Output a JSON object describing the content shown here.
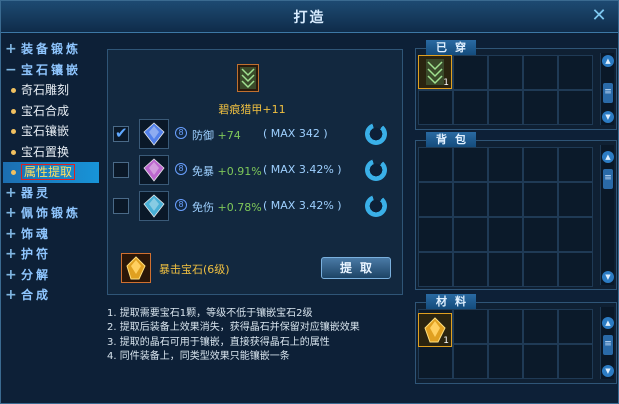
{
  "window": {
    "title": "打造"
  },
  "nav": [
    {
      "type": "cat",
      "sign": "+",
      "label": "装备锻炼"
    },
    {
      "type": "cat",
      "sign": "−",
      "label": "宝石镶嵌"
    },
    {
      "type": "sub",
      "label": "奇石雕刻"
    },
    {
      "type": "sub",
      "label": "宝石合成"
    },
    {
      "type": "sub",
      "label": "宝石镶嵌"
    },
    {
      "type": "sub",
      "label": "宝石置换"
    },
    {
      "type": "sub",
      "label": "属性提取",
      "selected": true
    },
    {
      "type": "cat",
      "sign": "+",
      "label": "器灵"
    },
    {
      "type": "cat",
      "sign": "+",
      "label": "佩饰锻炼"
    },
    {
      "type": "cat",
      "sign": "+",
      "label": "饰魂"
    },
    {
      "type": "cat",
      "sign": "+",
      "label": "护符"
    },
    {
      "type": "cat",
      "sign": "+",
      "label": "分解"
    },
    {
      "type": "cat",
      "sign": "+",
      "label": "合成"
    }
  ],
  "equip": {
    "name": "碧痕猎甲+11"
  },
  "attrs": [
    {
      "checked": true,
      "name": "防御",
      "value": "+74",
      "max": "( MAX 342 )",
      "gem_color": "#5a8cff"
    },
    {
      "checked": false,
      "name": "免暴",
      "value": "+0.91%",
      "max": "( MAX 3.42% )",
      "gem_color": "#d070e0"
    },
    {
      "checked": false,
      "name": "免伤",
      "value": "+0.78%",
      "max": "( MAX 3.42% )",
      "gem_color": "#50c0e8"
    }
  ],
  "material": {
    "name": "暴击宝石(6级)"
  },
  "extract_button": "提取",
  "notes": [
    "1. 提取需要宝石1颗，等级不低于镶嵌宝石2级",
    "2. 提取后装备上效果消失，获得晶石并保留对应镶嵌效果",
    "3. 提取的晶石可用于镶嵌，直接获得晶石上的属性",
    "4. 同件装备上，同类型效果只能镶嵌一条"
  ],
  "panels": {
    "worn": {
      "title": "已穿",
      "item_count": "1"
    },
    "bag": {
      "title": "背包"
    },
    "material": {
      "title": "材料",
      "item_count": "1"
    }
  }
}
